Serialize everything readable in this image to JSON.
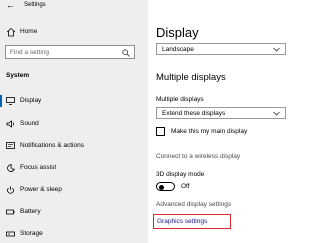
{
  "window": {
    "title": "Settings"
  },
  "sidebar": {
    "home_label": "Home",
    "search": {
      "placeholder": "Find a setting"
    },
    "section_label": "System",
    "items": [
      {
        "label": "Display",
        "icon": "monitor-icon",
        "active": true
      },
      {
        "label": "Sound",
        "icon": "speaker-icon"
      },
      {
        "label": "Notifications & actions",
        "icon": "notification-icon"
      },
      {
        "label": "Focus assist",
        "icon": "moon-icon"
      },
      {
        "label": "Power & sleep",
        "icon": "power-icon"
      },
      {
        "label": "Battery",
        "icon": "battery-icon"
      },
      {
        "label": "Storage",
        "icon": "storage-icon"
      }
    ]
  },
  "main": {
    "title": "Display",
    "orientation": {
      "value": "Landscape"
    },
    "multiple_displays": {
      "heading": "Multiple displays",
      "field_label": "Multiple displays",
      "value": "Extend these displays",
      "checkbox_label": "Make this my main display"
    },
    "links": {
      "wireless": "Connect to a wireless display",
      "advanced": "Advanced display settings",
      "graphics": "Graphics settings"
    },
    "mode_3d": {
      "label": "3D display mode",
      "state": "Off"
    }
  },
  "colors": {
    "accent": "#0063b1",
    "highlight": "#e0282e"
  }
}
